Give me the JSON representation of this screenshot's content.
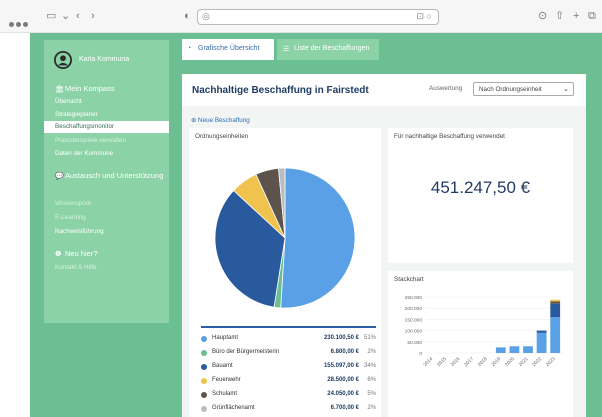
{
  "browser": {
    "url_placeholder": "",
    "url_icon": "lock-icon"
  },
  "sidebar": {
    "user_name": "Karla Kommuna",
    "sections": [
      {
        "label": "Mein Kompass",
        "icon": "bank-icon"
      },
      {
        "label": "Austausch und Unterstützung",
        "icon": "chat-icon"
      },
      {
        "label": "Neu hier?",
        "icon": "info-icon"
      }
    ],
    "items": [
      {
        "label": "Übersicht"
      },
      {
        "label": "Strategieplaner"
      },
      {
        "label": "Beschaffungsmonitor"
      },
      {
        "label": "Praxisbeispiele verwalten"
      },
      {
        "label": "Daten der Kommune"
      },
      {
        "label": "Wissenspool"
      },
      {
        "label": "E-Learning"
      },
      {
        "label": "Nachweisführung"
      },
      {
        "label": "Kontakt & Hilfe"
      }
    ]
  },
  "tabs": [
    {
      "label": "Grafische Übersicht",
      "icon": "chart-icon"
    },
    {
      "label": "Liste der Beschaffungen",
      "icon": "list-icon"
    }
  ],
  "main": {
    "title": "Nachhaltige Beschaffung in Fairstedt",
    "auswertung_label": "Auswertung",
    "select_value": "Nach Ordnungseinheit",
    "new_link": "Neue Beschaffung"
  },
  "card_units": {
    "title": "Ordnungseinheiten",
    "legend": [
      {
        "name": "Hauptamt",
        "value": "230.100,50 €",
        "pct": "51%",
        "color": "#5aa0e6"
      },
      {
        "name": "Büro der Bürgermeisterin",
        "value": "6.800,00 €",
        "pct": "2%",
        "color": "#6bbf93"
      },
      {
        "name": "Bauamt",
        "value": "155.097,00 €",
        "pct": "34%",
        "color": "#2a5a9e"
      },
      {
        "name": "Feuerwehr",
        "value": "28.500,00 €",
        "pct": "6%",
        "color": "#f0c24e"
      },
      {
        "name": "Schulamt",
        "value": "24.050,00 €",
        "pct": "5%",
        "color": "#5c544c"
      },
      {
        "name": "Grünflächenamt",
        "value": "6.700,00 €",
        "pct": "2%",
        "color": "#b9bcc1"
      }
    ]
  },
  "card_total": {
    "title": "Für nachhaltige Beschaffung verwendet",
    "value": "451.247,50 €"
  },
  "card_stack": {
    "title": "Stackchart"
  },
  "chart_data": [
    {
      "type": "pie",
      "title": "Ordnungseinheiten",
      "labels": [
        "Hauptamt",
        "Büro der Bürgermeisterin",
        "Bauamt",
        "Feuerwehr",
        "Schulamt",
        "Grünflächenamt"
      ],
      "values": [
        230100.5,
        6800,
        155097,
        28500,
        24050,
        6700
      ],
      "colors": [
        "#5aa0e6",
        "#6bbf93",
        "#2a5a9e",
        "#f0c24e",
        "#5c544c",
        "#b9bcc1"
      ]
    },
    {
      "type": "bar",
      "title": "Stackchart",
      "categories": [
        "2014",
        "2015",
        "2016",
        "2017",
        "2018",
        "2019",
        "2020",
        "2021",
        "2022",
        "2023"
      ],
      "y_ticks": [
        "0",
        "50.000",
        "100.000",
        "150.000",
        "200.000",
        "250.000"
      ],
      "ylim": [
        0,
        250000
      ],
      "series": [
        {
          "values": [
            0,
            0,
            0,
            0,
            0,
            25000,
            30000,
            30000,
            90000,
            160000
          ],
          "color": "#5aa0e6"
        },
        {
          "values": [
            0,
            0,
            0,
            0,
            0,
            0,
            0,
            0,
            10000,
            60000
          ],
          "color": "#2a5a9e"
        },
        {
          "values": [
            0,
            0,
            0,
            0,
            0,
            0,
            0,
            0,
            0,
            10000
          ],
          "color": "#5c544c"
        },
        {
          "values": [
            0,
            0,
            0,
            0,
            0,
            0,
            0,
            0,
            0,
            8000
          ],
          "color": "#f0c24e"
        }
      ]
    }
  ]
}
